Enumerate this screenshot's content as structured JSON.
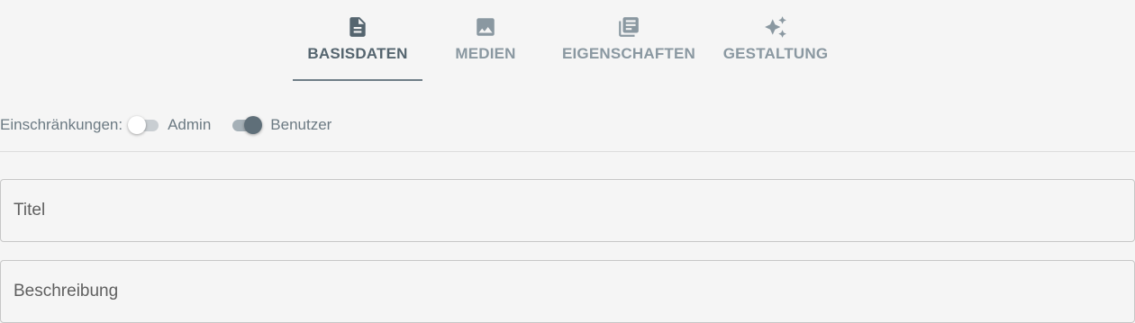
{
  "tabs": [
    {
      "label": "BASISDATEN",
      "icon": "document-icon",
      "active": true
    },
    {
      "label": "MEDIEN",
      "icon": "image-icon",
      "active": false
    },
    {
      "label": "EIGENSCHAFTEN",
      "icon": "library-books-icon",
      "active": false
    },
    {
      "label": "GESTALTUNG",
      "icon": "sparkles-icon",
      "active": false
    }
  ],
  "restrictions": {
    "label": "Einschränkungen:",
    "toggles": [
      {
        "label": "Admin",
        "checked": false
      },
      {
        "label": "Benutzer",
        "checked": true
      }
    ]
  },
  "form": {
    "title": {
      "placeholder": "Titel",
      "value": ""
    },
    "description": {
      "placeholder": "Beschreibung",
      "value": ""
    }
  },
  "colors": {
    "background": "#f5f5f5",
    "tab_text": "#8a98a1",
    "tab_active_text": "#55656f",
    "accent": "#6f7e87",
    "toggle_on": "#5f6f79"
  }
}
